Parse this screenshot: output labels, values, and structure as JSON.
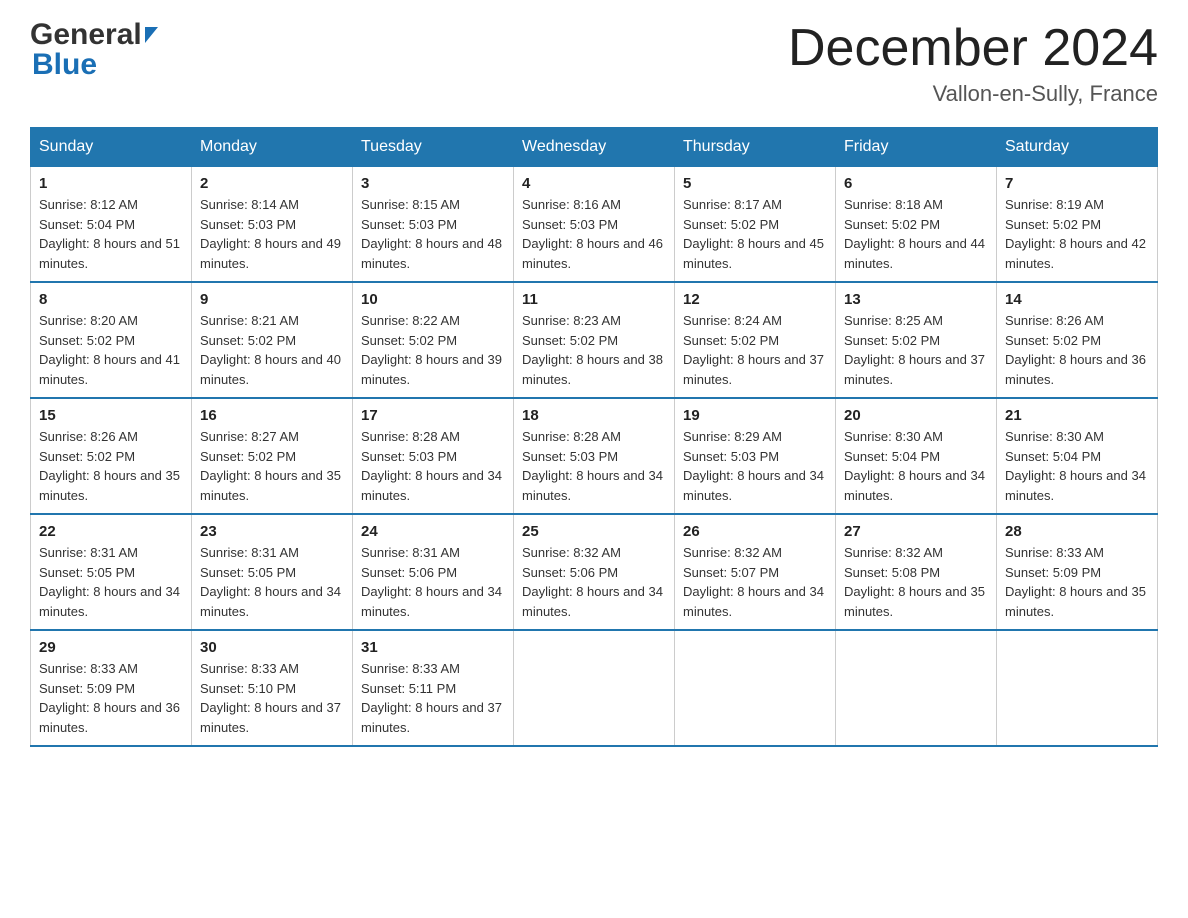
{
  "header": {
    "logo_general": "General",
    "logo_blue": "Blue",
    "month_title": "December 2024",
    "location": "Vallon-en-Sully, France"
  },
  "columns": [
    "Sunday",
    "Monday",
    "Tuesday",
    "Wednesday",
    "Thursday",
    "Friday",
    "Saturday"
  ],
  "weeks": [
    [
      {
        "day": "1",
        "sunrise": "8:12 AM",
        "sunset": "5:04 PM",
        "daylight": "8 hours and 51 minutes."
      },
      {
        "day": "2",
        "sunrise": "8:14 AM",
        "sunset": "5:03 PM",
        "daylight": "8 hours and 49 minutes."
      },
      {
        "day": "3",
        "sunrise": "8:15 AM",
        "sunset": "5:03 PM",
        "daylight": "8 hours and 48 minutes."
      },
      {
        "day": "4",
        "sunrise": "8:16 AM",
        "sunset": "5:03 PM",
        "daylight": "8 hours and 46 minutes."
      },
      {
        "day": "5",
        "sunrise": "8:17 AM",
        "sunset": "5:02 PM",
        "daylight": "8 hours and 45 minutes."
      },
      {
        "day": "6",
        "sunrise": "8:18 AM",
        "sunset": "5:02 PM",
        "daylight": "8 hours and 44 minutes."
      },
      {
        "day": "7",
        "sunrise": "8:19 AM",
        "sunset": "5:02 PM",
        "daylight": "8 hours and 42 minutes."
      }
    ],
    [
      {
        "day": "8",
        "sunrise": "8:20 AM",
        "sunset": "5:02 PM",
        "daylight": "8 hours and 41 minutes."
      },
      {
        "day": "9",
        "sunrise": "8:21 AM",
        "sunset": "5:02 PM",
        "daylight": "8 hours and 40 minutes."
      },
      {
        "day": "10",
        "sunrise": "8:22 AM",
        "sunset": "5:02 PM",
        "daylight": "8 hours and 39 minutes."
      },
      {
        "day": "11",
        "sunrise": "8:23 AM",
        "sunset": "5:02 PM",
        "daylight": "8 hours and 38 minutes."
      },
      {
        "day": "12",
        "sunrise": "8:24 AM",
        "sunset": "5:02 PM",
        "daylight": "8 hours and 37 minutes."
      },
      {
        "day": "13",
        "sunrise": "8:25 AM",
        "sunset": "5:02 PM",
        "daylight": "8 hours and 37 minutes."
      },
      {
        "day": "14",
        "sunrise": "8:26 AM",
        "sunset": "5:02 PM",
        "daylight": "8 hours and 36 minutes."
      }
    ],
    [
      {
        "day": "15",
        "sunrise": "8:26 AM",
        "sunset": "5:02 PM",
        "daylight": "8 hours and 35 minutes."
      },
      {
        "day": "16",
        "sunrise": "8:27 AM",
        "sunset": "5:02 PM",
        "daylight": "8 hours and 35 minutes."
      },
      {
        "day": "17",
        "sunrise": "8:28 AM",
        "sunset": "5:03 PM",
        "daylight": "8 hours and 34 minutes."
      },
      {
        "day": "18",
        "sunrise": "8:28 AM",
        "sunset": "5:03 PM",
        "daylight": "8 hours and 34 minutes."
      },
      {
        "day": "19",
        "sunrise": "8:29 AM",
        "sunset": "5:03 PM",
        "daylight": "8 hours and 34 minutes."
      },
      {
        "day": "20",
        "sunrise": "8:30 AM",
        "sunset": "5:04 PM",
        "daylight": "8 hours and 34 minutes."
      },
      {
        "day": "21",
        "sunrise": "8:30 AM",
        "sunset": "5:04 PM",
        "daylight": "8 hours and 34 minutes."
      }
    ],
    [
      {
        "day": "22",
        "sunrise": "8:31 AM",
        "sunset": "5:05 PM",
        "daylight": "8 hours and 34 minutes."
      },
      {
        "day": "23",
        "sunrise": "8:31 AM",
        "sunset": "5:05 PM",
        "daylight": "8 hours and 34 minutes."
      },
      {
        "day": "24",
        "sunrise": "8:31 AM",
        "sunset": "5:06 PM",
        "daylight": "8 hours and 34 minutes."
      },
      {
        "day": "25",
        "sunrise": "8:32 AM",
        "sunset": "5:06 PM",
        "daylight": "8 hours and 34 minutes."
      },
      {
        "day": "26",
        "sunrise": "8:32 AM",
        "sunset": "5:07 PM",
        "daylight": "8 hours and 34 minutes."
      },
      {
        "day": "27",
        "sunrise": "8:32 AM",
        "sunset": "5:08 PM",
        "daylight": "8 hours and 35 minutes."
      },
      {
        "day": "28",
        "sunrise": "8:33 AM",
        "sunset": "5:09 PM",
        "daylight": "8 hours and 35 minutes."
      }
    ],
    [
      {
        "day": "29",
        "sunrise": "8:33 AM",
        "sunset": "5:09 PM",
        "daylight": "8 hours and 36 minutes."
      },
      {
        "day": "30",
        "sunrise": "8:33 AM",
        "sunset": "5:10 PM",
        "daylight": "8 hours and 37 minutes."
      },
      {
        "day": "31",
        "sunrise": "8:33 AM",
        "sunset": "5:11 PM",
        "daylight": "8 hours and 37 minutes."
      },
      null,
      null,
      null,
      null
    ]
  ],
  "colors": {
    "header_bg": "#2176ae",
    "border_accent": "#2176ae"
  }
}
